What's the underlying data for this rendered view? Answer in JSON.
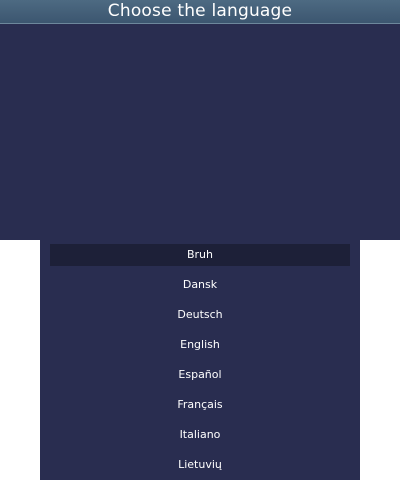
{
  "header": {
    "title": "Choose the language"
  },
  "languages": [
    {
      "label": "Bruh",
      "selected": true
    },
    {
      "label": "Dansk"
    },
    {
      "label": "Deutsch"
    },
    {
      "label": "English"
    },
    {
      "label": "Español"
    },
    {
      "label": "Français"
    },
    {
      "label": "Italiano"
    },
    {
      "label": "Lietuvių"
    }
  ],
  "colors": {
    "background": "#292d50",
    "title_bar": "#3c5670",
    "selected_row": "#1d2038",
    "text": "#ffffff"
  }
}
